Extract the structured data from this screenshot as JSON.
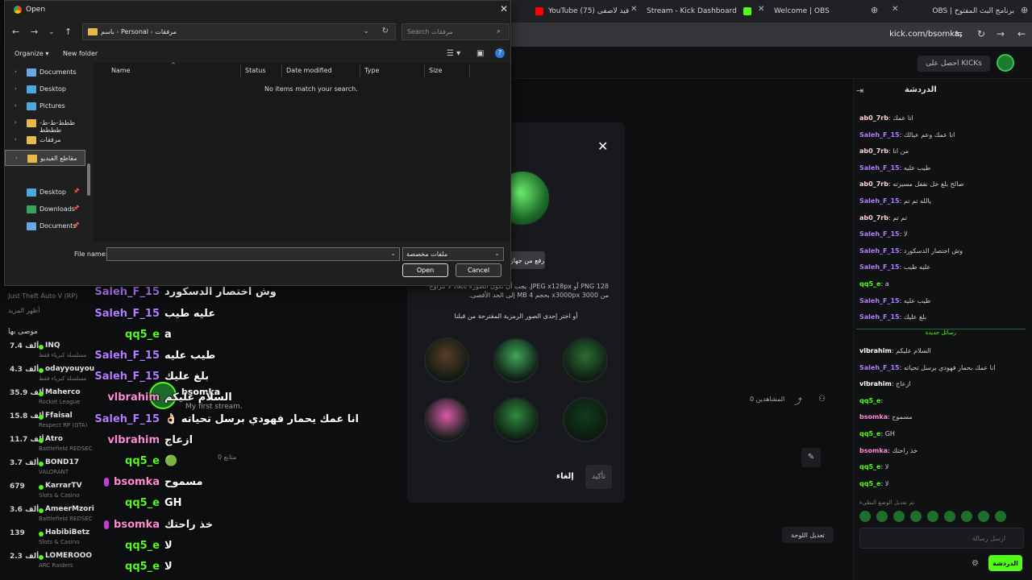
{
  "browser": {
    "tabs": [
      {
        "title": "YouTube (75) فيد لاصفى",
        "icon_color": "#ff0000"
      },
      {
        "title": "Stream - Kick Dashboard",
        "icon_color": "#53fc18"
      },
      {
        "title": "Welcome | OBS",
        "icon_color": "#bbbbbb"
      },
      {
        "title": "برنامج البث المفتوح | OBS",
        "icon_color": "#bbbbbb"
      }
    ],
    "url": "kick.com/bsomka"
  },
  "kick": {
    "get_kicks": "احصل على KICKs",
    "sidebar": {
      "heading": "أظهر المزيد",
      "recommended": "موصى بها",
      "suggested_partial": "Just Theft Auto V (RP)",
      "items": [
        {
          "name": "INQ",
          "count": "7.4 ألف",
          "category": "مسلسلة كبرياء فقط"
        },
        {
          "name": "odayyouyou",
          "count": "4.3 ألف",
          "category": "مسلسلة كبرياء فقط"
        },
        {
          "name": "Maherco",
          "count": "35.9 ألف",
          "category": "Rocket League"
        },
        {
          "name": "Ffaisal",
          "count": "15.8 ألف",
          "category": "Respect RP (GTA)"
        },
        {
          "name": "Atro",
          "count": "11.7 ألف",
          "category": "Battlefield REDSEC"
        },
        {
          "name": "BOND17",
          "count": "3.7 ألف",
          "category": "VALORANT"
        },
        {
          "name": "KarrarTV",
          "count": "679",
          "category": "Slots & Casino"
        },
        {
          "name": "AmeerMzori",
          "count": "3.6 ألف",
          "category": "Battlefield REDSEC"
        },
        {
          "name": "HabibiBetz",
          "count": "139",
          "category": "Slots & Casino"
        },
        {
          "name": "LOMEROOO",
          "count": "2.3 ألف",
          "category": "ARC Raiders"
        }
      ]
    },
    "stream": {
      "streamer": "bsomka",
      "title": "My first stream.",
      "followers": "متابع 0",
      "viewers": "المشاهدين 0",
      "edit_layout": "تعديل اللوحة"
    },
    "modal": {
      "upload_label": "رفع من جهاز",
      "hint": "PNG 128 أو JPEG x128px. يجب أن تكون الصورة بأبعاد لا تتراوح من 3000 x3000px بحجم 4 MB إلى الحد الأقصى.",
      "suggest_title": "أو اختر إحدى الصور الرمزية المقترحة من قبلنا",
      "cancel": "إلغاء",
      "confirm": "تأكيد",
      "suggest_colors": [
        "#5a3b2a",
        "#3fa65a",
        "#2c6e32",
        "#d85aa8",
        "#2f8a3e",
        "#0f3a1c"
      ]
    },
    "chat": {
      "title": "الدردشة",
      "new_messages": "رسائل جديدة",
      "input_placeholder": "ارسل رسالة",
      "send": "الدردشة",
      "lines": [
        {
          "user": "ab0_7rb",
          "color": "#ffd0d0",
          "msg": "انا عمك"
        },
        {
          "user": "Saleh_F_15",
          "color": "#b47cff",
          "msg": "انا عمك وعم عيالك"
        },
        {
          "user": "ab0_7rb",
          "color": "#ffd0d0",
          "msg": "من انا"
        },
        {
          "user": "Saleh_F_15",
          "color": "#b47cff",
          "msg": "طيب عليه"
        },
        {
          "user": "ab0_7rb",
          "color": "#ffd0d0",
          "msg": "صالح بلغ خل نقفل مسيرته"
        },
        {
          "user": "Saleh_F_15",
          "color": "#b47cff",
          "msg": "يالله تم تم"
        },
        {
          "user": "ab0_7rb",
          "color": "#ffd0d0",
          "msg": "تم تم"
        },
        {
          "user": "Saleh_F_15",
          "color": "#b47cff",
          "msg": "لا"
        },
        {
          "user": "Saleh_F_15",
          "color": "#b47cff",
          "msg": "وش اختصار الدسكورد"
        },
        {
          "user": "Saleh_F_15",
          "color": "#b47cff",
          "msg": "عليه طيب"
        },
        {
          "user": "qq5_e",
          "color": "#53fc18",
          "msg": "a"
        },
        {
          "user": "Saleh_F_15",
          "color": "#b47cff",
          "msg": "طيب عليه"
        },
        {
          "user": "Saleh_F_15",
          "color": "#b47cff",
          "msg": "بلغ عليك"
        }
      ],
      "lines_after": [
        {
          "user": "vlbrahim",
          "color": "#ffffff",
          "msg": "السلام عليكم"
        },
        {
          "user": "Saleh_F_15",
          "color": "#b47cff",
          "msg": "انا عمك بحمار فهودي برسل تحياته"
        },
        {
          "user": "vlbrahim",
          "color": "#ffffff",
          "msg": "ازعاج"
        },
        {
          "user": "qq5_e",
          "color": "#53fc18",
          "msg": ""
        },
        {
          "user": "bsomka",
          "color": "#ff8ad8",
          "msg": "مسموح"
        },
        {
          "user": "qq5_e",
          "color": "#53fc18",
          "msg": "GH"
        },
        {
          "user": "bsomka",
          "color": "#ff8ad8",
          "msg": "خذ راحتك"
        },
        {
          "user": "qq5_e",
          "color": "#53fc18",
          "msg": "لا"
        },
        {
          "user": "qq5_e",
          "color": "#53fc18",
          "msg": "لا"
        }
      ],
      "footer_hint": "تم تعديل الوضع البطيء"
    }
  },
  "overlay": {
    "messages": [
      {
        "user": "bsomka",
        "color": "#ff8ad8",
        "msg": "سلام عليكم",
        "mic": true
      },
      {
        "user": "ab0_7rb",
        "color": "#9bbcff",
        "msg": "انا عمك",
        "mic": false
      },
      {
        "user": "Saleh_F_15",
        "color": "#b47cff",
        "msg": "انا عمك وعم عيالك",
        "mic": false
      },
      {
        "user": "ab0_7rb",
        "color": "#9bbcff",
        "msg": "من انا",
        "mic": false
      },
      {
        "user": "Saleh_F_15",
        "color": "#b47cff",
        "msg": "طيب عليه",
        "mic": false
      },
      {
        "user": "ab0_7rb",
        "color": "#9bbcff",
        "msg": "صالح بلغ خل نقفل مسيرته",
        "mic": false
      },
      {
        "user": "Saleh_F_15",
        "color": "#b47cff",
        "msg": "يالله تم تم",
        "mic": false
      },
      {
        "user": "ab0_7rb",
        "color": "#9bbcff",
        "msg": "تم تم",
        "mic": false
      },
      {
        "user": "Saleh_F_15",
        "color": "#b47cff",
        "msg": "لا",
        "mic": false
      },
      {
        "user": "Saleh_F_15",
        "color": "#b47cff",
        "msg": "وش اختصار الدسكورد",
        "mic": false
      },
      {
        "user": "Saleh_F_15",
        "color": "#b47cff",
        "msg": "عليه طيب",
        "mic": false
      },
      {
        "user": "qq5_e",
        "color": "#53fc18",
        "msg": "a",
        "mic": false
      },
      {
        "user": "Saleh_F_15",
        "color": "#b47cff",
        "msg": "طيب عليه",
        "mic": false
      },
      {
        "user": "Saleh_F_15",
        "color": "#b47cff",
        "msg": "بلغ عليك",
        "mic": false
      },
      {
        "user": "vlbrahim",
        "color": "#ff8ad8",
        "msg": "السلام عليكم",
        "mic": false
      },
      {
        "user": "Saleh_F_15",
        "color": "#b47cff",
        "msg": "انا عمك يحمار فهودي برسل تحياته 👌🏻",
        "mic": false
      },
      {
        "user": "vlbrahim",
        "color": "#ff8ad8",
        "msg": "ازعاج",
        "mic": false
      },
      {
        "user": "qq5_e",
        "color": "#53fc18",
        "msg": "🟢",
        "mic": false
      },
      {
        "user": "bsomka",
        "color": "#ff8ad8",
        "msg": "مسموح",
        "mic": true
      },
      {
        "user": "qq5_e",
        "color": "#53fc18",
        "msg": "GH",
        "mic": false
      },
      {
        "user": "bsomka",
        "color": "#ff8ad8",
        "msg": "خذ راحتك",
        "mic": true
      },
      {
        "user": "qq5_e",
        "color": "#53fc18",
        "msg": "لا",
        "mic": false
      },
      {
        "user": "qq5_e",
        "color": "#53fc18",
        "msg": "لا",
        "mic": false
      }
    ]
  },
  "dialog": {
    "title": "Open",
    "breadcrumb": [
      "باسم",
      "Personal",
      "مرفقات"
    ],
    "search_placeholder": "Search مرفقات",
    "organize": "Organize ▾",
    "new_folder": "New folder",
    "columns": [
      "Name",
      "Status",
      "Date modified",
      "Type",
      "Size"
    ],
    "empty": "No items match your search.",
    "nav": [
      {
        "label": "Documents",
        "color": "#6aa7e8",
        "chev": true
      },
      {
        "label": "Desktop",
        "color": "#4ea8e0",
        "chev": true
      },
      {
        "label": "Pictures",
        "color": "#4ea8e0",
        "chev": true
      },
      {
        "label": "ططط-ط-ط-طططط",
        "color": "#e8b84a",
        "chev": true
      },
      {
        "label": "مرفقات",
        "color": "#e8b84a",
        "chev": true
      },
      {
        "label": "مقاطع الفيديو",
        "color": "#e8b84a",
        "chev": true
      },
      {
        "label": "Desktop",
        "color": "#4ea8e0",
        "chev": false,
        "pin": true
      },
      {
        "label": "Downloads",
        "color": "#3aa35a",
        "chev": false,
        "pin": true
      },
      {
        "label": "Documents",
        "color": "#6aa7e8",
        "chev": false,
        "pin": true
      }
    ],
    "file_name_label": "File name:",
    "file_name_value": "",
    "file_type": "ملفات مخصصة",
    "open": "Open",
    "cancel": "Cancel"
  }
}
